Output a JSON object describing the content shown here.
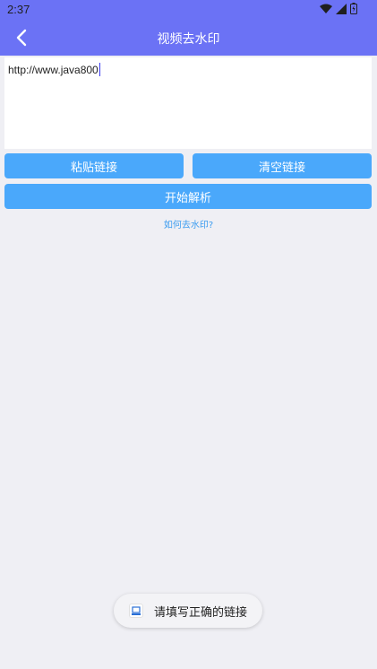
{
  "status_bar": {
    "time": "2:37",
    "icons": [
      "wifi-icon",
      "signal-icon",
      "battery-icon"
    ]
  },
  "app_bar": {
    "title": "视频去水印",
    "back_icon": "chevron-left-icon"
  },
  "url_input": {
    "value": "http://www.java800"
  },
  "buttons": {
    "paste": "粘贴链接",
    "clear": "清空链接",
    "parse": "开始解析"
  },
  "help_link": "如何去水印?",
  "toast": {
    "message": "请填写正确的链接"
  },
  "colors": {
    "primary": "#6b72f5",
    "button": "#4aa8fb",
    "link": "#3b9cf0",
    "background": "#efeff4"
  }
}
